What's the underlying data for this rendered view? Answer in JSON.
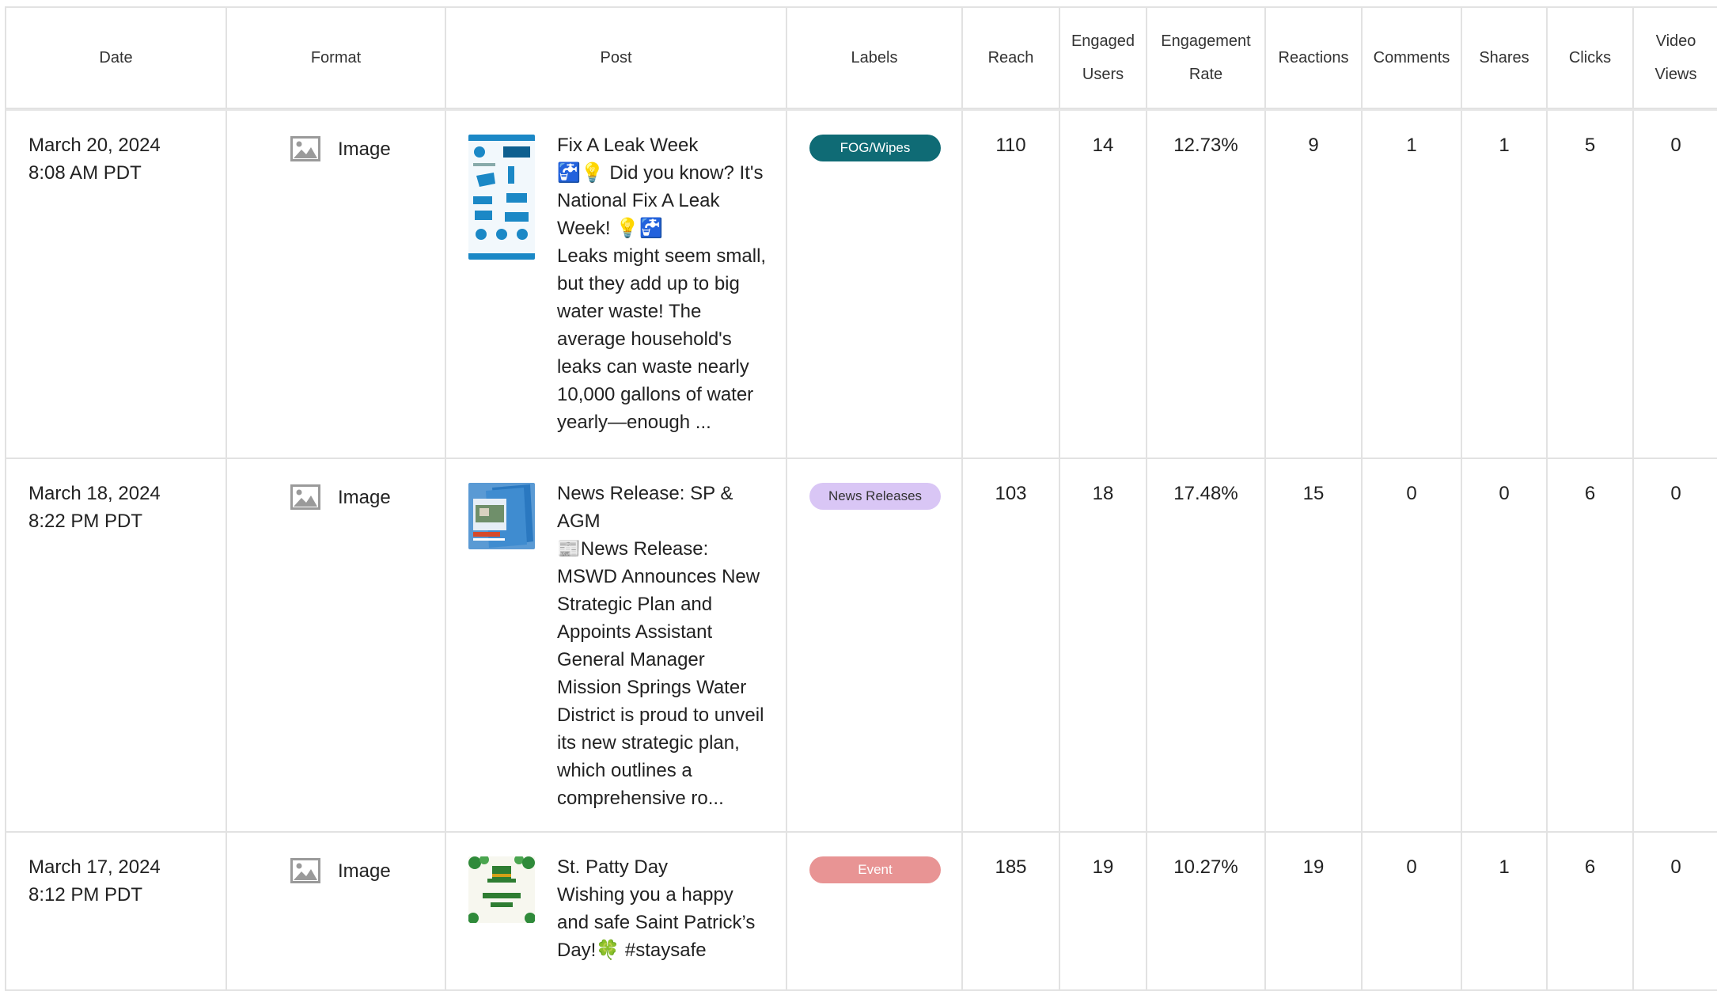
{
  "headers": {
    "date": "Date",
    "format": "Format",
    "post": "Post",
    "labels": "Labels",
    "reach": "Reach",
    "engaged_users": "Engaged Users",
    "engagement_rate": "Engagement Rate",
    "reactions": "Reactions",
    "comments": "Comments",
    "shares": "Shares",
    "clicks": "Clicks",
    "video_views": "Video Views"
  },
  "rows": [
    {
      "date": "March 20, 2024",
      "time": "8:08 AM PDT",
      "format": "Image",
      "format_icon": "image-icon",
      "post": "Fix A Leak Week\n🚰💡 Did you know? It's National Fix A Leak Week! 💡🚰\nLeaks might seem small, but they add up to big water waste! The average household's leaks can waste nearly 10,000 gallons of water yearly—enough ...",
      "label": "FOG/Wipes",
      "label_color": "#0f6b75",
      "reach": "110",
      "engaged_users": "14",
      "engagement_rate": "12.73%",
      "reactions": "9",
      "comments": "1",
      "shares": "1",
      "clicks": "5",
      "video_views": "0"
    },
    {
      "date": "March 18, 2024",
      "time": "8:22 PM PDT",
      "format": "Image",
      "format_icon": "image-icon",
      "post": "News Release: SP & AGM\n📰News Release: MSWD Announces New Strategic Plan and Appoints Assistant General Manager\nMission Springs Water District is proud to unveil its new strategic plan, which outlines a comprehensive ro...",
      "label": "News Releases",
      "label_color": "#d9c6f5",
      "reach": "103",
      "engaged_users": "18",
      "engagement_rate": "17.48%",
      "reactions": "15",
      "comments": "0",
      "shares": "0",
      "clicks": "6",
      "video_views": "0"
    },
    {
      "date": "March 17, 2024",
      "time": "8:12 PM PDT",
      "format": "Image",
      "format_icon": "image-icon",
      "post": "St. Patty Day\nWishing you a happy and safe Saint Patrick’s Day!🍀 #staysafe",
      "label": "Event",
      "label_color": "#e89494",
      "reach": "185",
      "engaged_users": "19",
      "engagement_rate": "10.27%",
      "reactions": "19",
      "comments": "0",
      "shares": "1",
      "clicks": "6",
      "video_views": "0"
    }
  ]
}
